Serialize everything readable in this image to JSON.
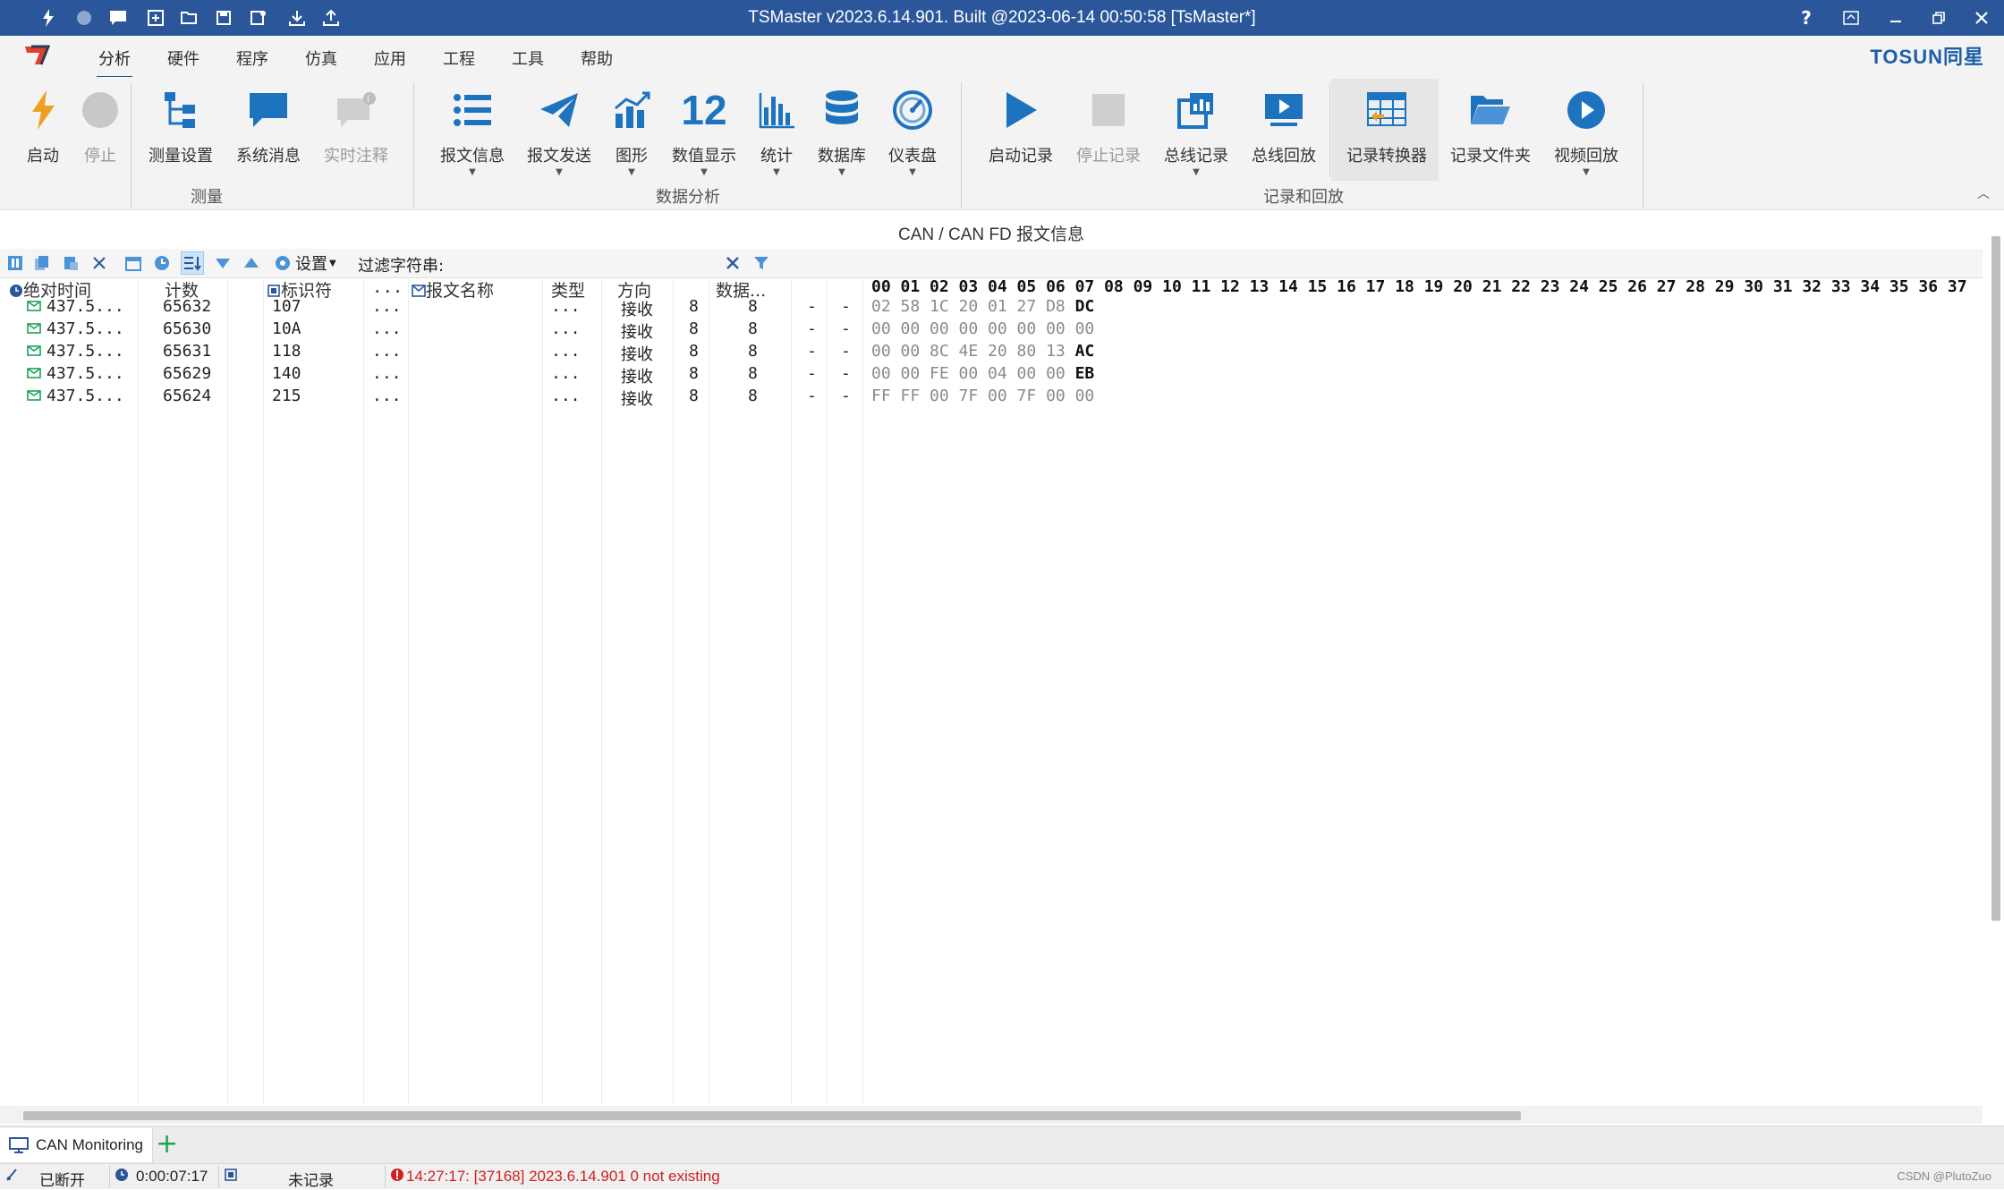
{
  "window": {
    "title": "TSMaster v2023.6.14.901. Built @2023-06-14 00:50:58 [TsMaster*]",
    "help": "?",
    "brand": "TOSUN同星"
  },
  "menu_tabs": [
    "分析",
    "硬件",
    "程序",
    "仿真",
    "应用",
    "工程",
    "工具",
    "帮助"
  ],
  "ribbon": {
    "groups": [
      "测量",
      "数据分析",
      "记录和回放"
    ],
    "buttons": [
      "启动",
      "停止",
      "测量设置",
      "系统消息",
      "实时注释",
      "报文信息",
      "报文发送",
      "图形",
      "数值显示",
      "统计",
      "数据库",
      "仪表盘",
      "启动记录",
      "停止记录",
      "总线记录",
      "总线回放",
      "记录转换器",
      "记录文件夹",
      "视频回放"
    ],
    "numeric_icon_text": "12"
  },
  "panel": {
    "title": "CAN / CAN FD 报文信息",
    "settings_label": "设置",
    "filter_label": "过滤字符串:",
    "filter_value": ""
  },
  "table": {
    "headers": {
      "time": "绝对时间",
      "count": "计数",
      "id": "标识符",
      "dots": "...",
      "name": "报文名称",
      "type": "类型",
      "dir": "方向",
      "data": "数据..."
    },
    "hex_header": "00 01 02 03 04 05 06 07 08 09 10 11 12 13 14 15 16 17 18 19 20 21 22 23 24 25 26 27 28 29 30 31 32 33 34 35 36 37",
    "rows": [
      {
        "time": "437.5...",
        "count": "65632",
        "id": "107",
        "c1": "...",
        "type": "...",
        "dir": "接收",
        "dlc": "8",
        "len": "8",
        "a": "-",
        "b": "-",
        "hex": "02 58 1C 20 01 27 D8",
        "hex_last": "DC"
      },
      {
        "time": "437.5...",
        "count": "65630",
        "id": "10A",
        "c1": "...",
        "type": "...",
        "dir": "接收",
        "dlc": "8",
        "len": "8",
        "a": "-",
        "b": "-",
        "hex": "00 00 00 00 00 00 00 00",
        "hex_last": ""
      },
      {
        "time": "437.5...",
        "count": "65631",
        "id": "118",
        "c1": "...",
        "type": "...",
        "dir": "接收",
        "dlc": "8",
        "len": "8",
        "a": "-",
        "b": "-",
        "hex": "00 00 8C 4E 20 80 13",
        "hex_last": "AC"
      },
      {
        "time": "437.5...",
        "count": "65629",
        "id": "140",
        "c1": "...",
        "type": "...",
        "dir": "接收",
        "dlc": "8",
        "len": "8",
        "a": "-",
        "b": "-",
        "hex": "00 00 FE 00 04 00 00",
        "hex_last": "EB"
      },
      {
        "time": "437.5...",
        "count": "65624",
        "id": "215",
        "c1": "...",
        "type": "...",
        "dir": "接收",
        "dlc": "8",
        "len": "8",
        "a": "-",
        "b": "-",
        "hex": "FF FF 00 7F 00 7F 00 00",
        "hex_last": ""
      }
    ]
  },
  "bottom_tab": {
    "label": "CAN Monitoring",
    "add": "+"
  },
  "status": {
    "connection": "已断开",
    "elapsed": "0:00:07:17",
    "record": "未记录",
    "error": "14:27:17: [37168] 2023.6.14.901 0 not existing",
    "watermark": "CSDN @PlutoZuo"
  },
  "colors": {
    "accent": "#2b579a",
    "icon_blue": "#1e73be",
    "error": "#d02020"
  }
}
